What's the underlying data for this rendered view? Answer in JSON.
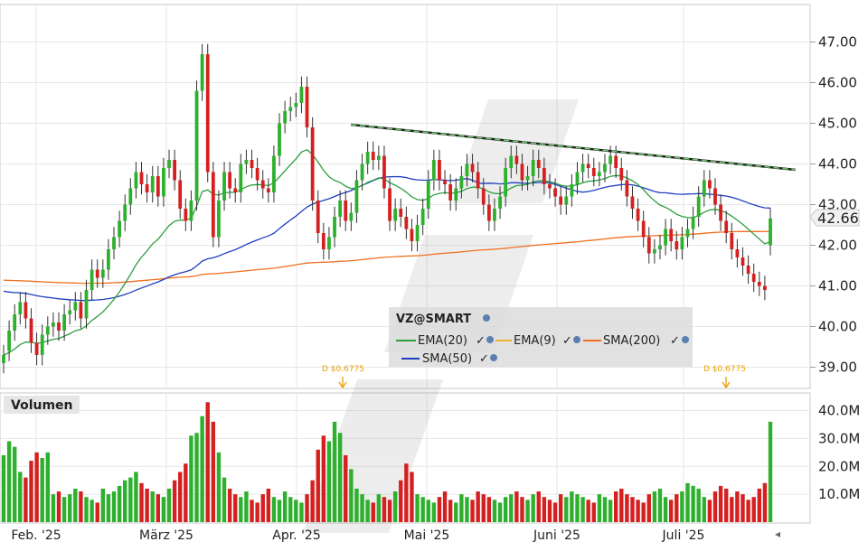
{
  "chart_data": [
    {
      "type": "candlestick",
      "symbol": "VZ@SMART",
      "ylim": [
        38.5,
        47.9
      ],
      "y_ticks": [
        "39.00",
        "40.00",
        "41.00",
        "42.00",
        "43.00",
        "44.00",
        "45.00",
        "46.00",
        "47.00"
      ],
      "x_labels": [
        "Feb. '25",
        "März '25",
        "Apr. '25",
        "Mai '25",
        "Juni '25",
        "Juli '25"
      ],
      "last_price": "42.66",
      "indicators": [
        {
          "name": "EMA(20)",
          "color": "#2e9e3e"
        },
        {
          "name": "EMA(9)",
          "color": "#f0b030"
        },
        {
          "name": "SMA(200)",
          "color": "#f07020"
        },
        {
          "name": "SMA(50)",
          "color": "#1f3fbf"
        }
      ],
      "dividends": [
        "D $0.6775",
        "D $0.6775"
      ],
      "closes": [
        39.3,
        39.9,
        40.3,
        40.6,
        40.2,
        39.6,
        39.3,
        39.8,
        40.0,
        40.1,
        39.9,
        40.3,
        40.4,
        40.6,
        40.2,
        40.9,
        41.4,
        41.2,
        41.4,
        41.9,
        42.2,
        42.6,
        43.0,
        43.4,
        43.8,
        43.5,
        43.3,
        43.7,
        43.2,
        43.9,
        44.1,
        43.6,
        42.9,
        42.6,
        43.1,
        45.8,
        46.7,
        43.8,
        42.2,
        43.1,
        43.8,
        43.4,
        43.3,
        44.0,
        44.1,
        43.9,
        43.6,
        43.4,
        43.3,
        44.2,
        45.0,
        45.3,
        45.4,
        45.5,
        45.9,
        44.9,
        43.1,
        42.3,
        41.9,
        42.2,
        42.7,
        43.1,
        42.6,
        42.8,
        43.6,
        44.0,
        44.3,
        44.1,
        44.2,
        43.4,
        42.6,
        42.9,
        42.7,
        42.4,
        42.1,
        42.5,
        42.9,
        43.6,
        44.1,
        43.6,
        43.5,
        43.1,
        43.4,
        43.7,
        44.0,
        43.8,
        43.4,
        43.0,
        42.6,
        42.9,
        43.2,
        43.9,
        44.2,
        44.0,
        43.6,
        43.7,
        44.1,
        43.9,
        43.5,
        43.4,
        43.2,
        43.0,
        43.2,
        43.5,
        43.8,
        44.0,
        43.9,
        43.7,
        43.8,
        44.0,
        44.2,
        43.9,
        43.6,
        43.2,
        42.9,
        42.6,
        42.2,
        41.8,
        41.9,
        42.0,
        42.4,
        42.1,
        41.9,
        42.2,
        42.4,
        42.7,
        43.2,
        43.6,
        43.4,
        43.0,
        42.6,
        42.3,
        41.9,
        41.7,
        41.5,
        41.3,
        41.1,
        41.0,
        40.9,
        42.66
      ],
      "opens": [
        39.1,
        39.4,
        39.9,
        40.3,
        40.6,
        40.2,
        39.6,
        39.3,
        39.8,
        40.0,
        40.1,
        39.9,
        40.3,
        40.4,
        40.6,
        40.2,
        40.9,
        41.4,
        41.2,
        41.4,
        41.9,
        42.2,
        42.6,
        43.0,
        43.4,
        43.8,
        43.5,
        43.3,
        43.7,
        43.2,
        43.9,
        44.1,
        43.6,
        42.9,
        42.6,
        43.1,
        45.8,
        46.7,
        43.8,
        42.2,
        43.1,
        43.8,
        43.4,
        43.3,
        44.0,
        44.1,
        43.9,
        43.6,
        43.4,
        43.3,
        44.2,
        45.0,
        45.3,
        45.4,
        45.5,
        45.9,
        44.9,
        43.1,
        42.3,
        41.9,
        42.2,
        42.7,
        43.1,
        42.6,
        42.8,
        43.6,
        44.0,
        44.3,
        44.1,
        44.2,
        43.4,
        42.6,
        42.9,
        42.7,
        42.4,
        42.1,
        42.5,
        42.9,
        43.6,
        44.1,
        43.6,
        43.5,
        43.1,
        43.4,
        43.7,
        44.0,
        43.8,
        43.4,
        43.0,
        42.6,
        42.9,
        43.2,
        43.9,
        44.2,
        44.0,
        43.6,
        43.7,
        44.1,
        43.9,
        43.5,
        43.4,
        43.2,
        43.0,
        43.2,
        43.5,
        43.8,
        44.0,
        43.9,
        43.7,
        43.8,
        44.0,
        44.2,
        43.9,
        43.6,
        43.2,
        42.9,
        42.6,
        42.2,
        41.8,
        41.9,
        42.0,
        42.4,
        42.1,
        41.9,
        42.2,
        42.4,
        42.7,
        43.2,
        43.6,
        43.4,
        43.0,
        42.6,
        42.3,
        41.9,
        41.7,
        41.5,
        41.3,
        41.1,
        41.0,
        42.0
      ]
    },
    {
      "type": "bar",
      "title": "Volumen",
      "ylim": [
        0,
        46
      ],
      "y_ticks": [
        "10.0M",
        "20.0M",
        "30.0M",
        "40.0M"
      ],
      "values": [
        24,
        29,
        27,
        18,
        16,
        22,
        25,
        23,
        25,
        10,
        11,
        9,
        10,
        12,
        11,
        9,
        8,
        7,
        12,
        10,
        11,
        13,
        15,
        16,
        18,
        14,
        12,
        11,
        10,
        9,
        12,
        15,
        18,
        21,
        31,
        32,
        38,
        43,
        36,
        25,
        16,
        12,
        10,
        9,
        11,
        8,
        7,
        10,
        12,
        9,
        8,
        11,
        9,
        8,
        7,
        10,
        15,
        26,
        31,
        29,
        36,
        32,
        24,
        19,
        12,
        10,
        8,
        7,
        10,
        9,
        8,
        11,
        15,
        21,
        18,
        10,
        9,
        8,
        7,
        9,
        11,
        8,
        7,
        10,
        9,
        8,
        11,
        10,
        9,
        8,
        7,
        9,
        10,
        11,
        9,
        8,
        10,
        11,
        9,
        8,
        7,
        10,
        9,
        11,
        10,
        9,
        8,
        7,
        10,
        9,
        8,
        11,
        12,
        10,
        9,
        8,
        7,
        10,
        11,
        12,
        9,
        8,
        10,
        11,
        14,
        13,
        12,
        9,
        8,
        11,
        13,
        12,
        9,
        11,
        10,
        8,
        9,
        12,
        14,
        36
      ]
    }
  ]
}
